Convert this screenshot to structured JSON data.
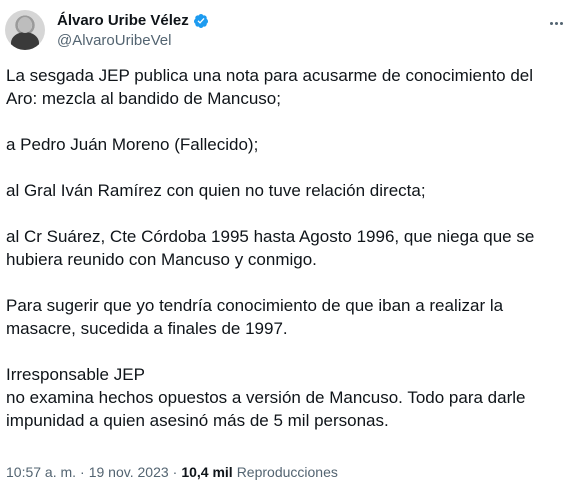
{
  "author": {
    "name": "Álvaro Uribe Vélez",
    "handle": "@AlvaroUribeVel",
    "verified_color": "#1d9bf0"
  },
  "tweet": {
    "paragraphs": [
      [
        "La sesgada JEP publica una nota para acusarme de conocimiento del",
        "Aro: mezcla al bandido de Mancuso;"
      ],
      [
        "a Pedro Juán Moreno (Fallecido);"
      ],
      [
        "al Gral Iván Ramírez con quien no tuve relación directa;"
      ],
      [
        "al Cr Suárez, Cte Córdoba 1995 hasta Agosto 1996, que niega que se",
        "hubiera reunido con Mancuso y conmigo."
      ],
      [
        "Para sugerir que yo tendría conocimiento de que iban a realizar la",
        "masacre, sucedida a finales de 1997."
      ],
      [
        "Irresponsable JEP",
        "no examina hechos opuestos a versión de Mancuso. Todo para darle",
        "impunidad a quien asesinó más de 5 mil personas."
      ]
    ]
  },
  "meta": {
    "time": "10:57 a. m.",
    "separator1": "·",
    "date": "19 nov. 2023",
    "separator2": "·",
    "views_count": "10,4 mil",
    "views_label": "Reproducciones"
  }
}
